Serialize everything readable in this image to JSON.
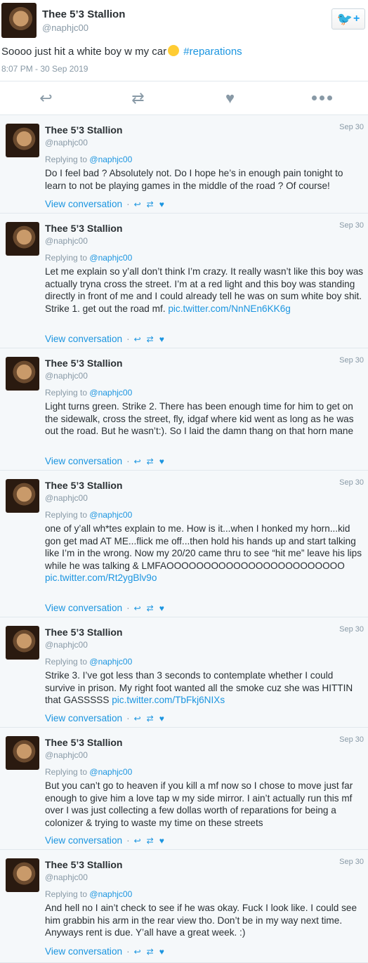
{
  "main": {
    "name": "Thee 5’3 Stallion",
    "handle": "@naphjc00",
    "text": "Soooo just hit a white boy w my car",
    "hashtag": "#reparations",
    "date": "8:07 PM - 30 Sep 2019",
    "follow_icon": "twitter-bird-icon",
    "follow_plus": "+"
  },
  "actions": {
    "reply": "↩",
    "retweet": "⇄",
    "like": "♥"
  },
  "replies": [
    {
      "name": "Thee 5’3 Stallion",
      "handle": "@naphjc00",
      "date": "Sep 30",
      "replying_label": "Replying to",
      "replying_to": "@naphjc00",
      "text": "Do I feel bad ? Absolutely not. Do I hope he’s in enough pain tonight to learn to not be playing games in the middle of the road ? Of course!",
      "link": "",
      "view": "View conversation"
    },
    {
      "name": "Thee 5’3 Stallion",
      "handle": "@naphjc00",
      "date": "Sep 30",
      "replying_label": "Replying to",
      "replying_to": "@naphjc00",
      "text": "Let me explain so y’all don’t think I’m crazy. It really wasn’t like this boy was actually tryna cross the street. I’m at a red light and this boy was standing directly in front of me and I could already tell he was on sum white boy shit. Strike 1. get out the road mf.",
      "link": "pic.twitter.com/NnNEn6KK6g",
      "view": "View conversation"
    },
    {
      "name": "Thee 5’3 Stallion",
      "handle": "@naphjc00",
      "date": "Sep 30",
      "replying_label": "Replying to",
      "replying_to": "@naphjc00",
      "text": "Light turns green. Strike 2. There has been enough time for him to get on the sidewalk, cross the street, fly, idgaf where kid went as long as he was out the road. But he wasn’t:). So I laid the damn thang on that horn mane",
      "link": "",
      "view": "View conversation"
    },
    {
      "name": "Thee 5’3 Stallion",
      "handle": "@naphjc00",
      "date": "Sep 30",
      "replying_label": "Replying to",
      "replying_to": "@naphjc00",
      "text": "one of y’all wh*tes explain to me. How is it...when I honked my horn...kid gon get mad AT ME...flick me off...then hold his hands up and start talking like I’m in the wrong. Now my 20/20 came thru to see “hit me” leave his lips while he was talking & LMFAOOOOOOOOOOOOOOOOOOOOOOOO",
      "link": "pic.twitter.com/Rt2ygBlv9o",
      "view": "View conversation"
    },
    {
      "name": "Thee 5’3 Stallion",
      "handle": "@naphjc00",
      "date": "Sep 30",
      "replying_label": "Replying to",
      "replying_to": "@naphjc00",
      "text": "Strike 3. I’ve got less than 3 seconds to contemplate whether I could survive in prison. My right foot wanted all the smoke cuz she was HITTIN that GASSSSS",
      "link": "pic.twitter.com/TbFkj6NIXs",
      "view": "View conversation"
    },
    {
      "name": "Thee 5’3 Stallion",
      "handle": "@naphjc00",
      "date": "Sep 30",
      "replying_label": "Replying to",
      "replying_to": "@naphjc00",
      "text": "But you can’t go to heaven if you kill a mf now so I chose to move just far enough to give him a love tap w my side mirror. I ain’t actually run this mf over I was just collecting a few dollas worth of reparations for being a colonizer & trying to waste my time on these streets",
      "link": "",
      "view": "View conversation"
    },
    {
      "name": "Thee 5’3 Stallion",
      "handle": "@naphjc00",
      "date": "Sep 30",
      "replying_label": "Replying to",
      "replying_to": "@naphjc00",
      "text": "And hell no I ain’t check to see if he was okay. Fuck I look like. I could see him grabbin his arm in the rear view tho. Don’t be in my way next time. Anyways rent is due. Y’all have a great week. :)",
      "link": "",
      "view": "View conversation"
    }
  ]
}
